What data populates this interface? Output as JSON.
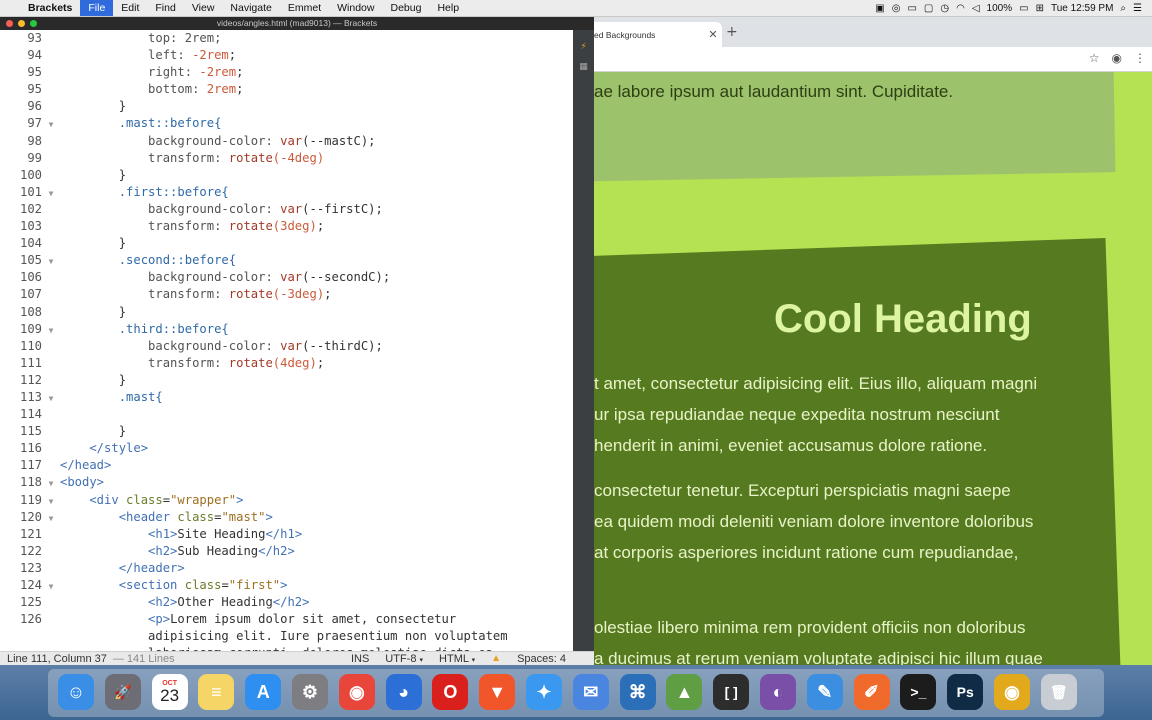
{
  "menubar": {
    "app_name": "Brackets",
    "menus": [
      "File",
      "Edit",
      "Find",
      "View",
      "Navigate",
      "Emmet",
      "Window",
      "Debug",
      "Help"
    ],
    "active_menu": "File",
    "battery": "100%",
    "clock": "Tue 12:59 PM"
  },
  "editor": {
    "window_title": "videos/angles.html (mad9013) — Brackets",
    "lines": [
      {
        "n": "93",
        "fold": "",
        "code": [
          {
            "t": "            top: 2rem;",
            "c": "k-prop"
          }
        ]
      },
      {
        "n": "94",
        "fold": "",
        "code": [
          {
            "t": "            left: ",
            "c": "k-prop"
          },
          {
            "t": "-2rem",
            "c": "k-val"
          },
          {
            "t": ";",
            "c": "txt"
          }
        ]
      },
      {
        "n": "95",
        "fold": "",
        "code": [
          {
            "t": "            right: ",
            "c": "k-prop"
          },
          {
            "t": "-2rem",
            "c": "k-val"
          },
          {
            "t": ";",
            "c": "txt"
          }
        ]
      },
      {
        "n": "95",
        "fold": "",
        "code": [
          {
            "t": "            bottom: ",
            "c": "k-prop"
          },
          {
            "t": "2rem",
            "c": "k-val"
          },
          {
            "t": ";",
            "c": "txt"
          }
        ]
      },
      {
        "n": "96",
        "fold": "",
        "code": [
          {
            "t": "        }",
            "c": "txt"
          }
        ]
      },
      {
        "n": "97",
        "fold": "▼",
        "code": [
          {
            "t": "        .mast::before{",
            "c": "k-sel"
          }
        ]
      },
      {
        "n": "98",
        "fold": "",
        "code": [
          {
            "t": "            background-color: ",
            "c": "k-prop"
          },
          {
            "t": "var",
            "c": "k-fn"
          },
          {
            "t": "(--mastC);",
            "c": "txt"
          }
        ]
      },
      {
        "n": "99",
        "fold": "",
        "code": [
          {
            "t": "            transform: ",
            "c": "k-prop"
          },
          {
            "t": "rotate",
            "c": "k-fn"
          },
          {
            "t": "(-4deg)",
            "c": "k-val"
          }
        ]
      },
      {
        "n": "100",
        "fold": "",
        "code": [
          {
            "t": "        }",
            "c": "txt"
          }
        ]
      },
      {
        "n": "101",
        "fold": "▼",
        "code": [
          {
            "t": "        .first::before{",
            "c": "k-sel"
          }
        ]
      },
      {
        "n": "102",
        "fold": "",
        "code": [
          {
            "t": "            background-color: ",
            "c": "k-prop"
          },
          {
            "t": "var",
            "c": "k-fn"
          },
          {
            "t": "(--firstC);",
            "c": "txt"
          }
        ]
      },
      {
        "n": "103",
        "fold": "",
        "code": [
          {
            "t": "            transform: ",
            "c": "k-prop"
          },
          {
            "t": "rotate",
            "c": "k-fn"
          },
          {
            "t": "(3deg)",
            "c": "k-val"
          },
          {
            "t": ";",
            "c": "txt"
          }
        ]
      },
      {
        "n": "104",
        "fold": "",
        "code": [
          {
            "t": "        }",
            "c": "txt"
          }
        ]
      },
      {
        "n": "105",
        "fold": "▼",
        "code": [
          {
            "t": "        .second::before{",
            "c": "k-sel"
          }
        ]
      },
      {
        "n": "106",
        "fold": "",
        "code": [
          {
            "t": "            background-color: ",
            "c": "k-prop"
          },
          {
            "t": "var",
            "c": "k-fn"
          },
          {
            "t": "(--secondC);",
            "c": "txt"
          }
        ]
      },
      {
        "n": "107",
        "fold": "",
        "code": [
          {
            "t": "            transform: ",
            "c": "k-prop"
          },
          {
            "t": "rotate",
            "c": "k-fn"
          },
          {
            "t": "(-3deg)",
            "c": "k-val"
          },
          {
            "t": ";",
            "c": "txt"
          }
        ]
      },
      {
        "n": "108",
        "fold": "",
        "code": [
          {
            "t": "        }",
            "c": "txt"
          }
        ]
      },
      {
        "n": "109",
        "fold": "▼",
        "code": [
          {
            "t": "        .third::before{",
            "c": "k-sel"
          }
        ]
      },
      {
        "n": "110",
        "fold": "",
        "code": [
          {
            "t": "            background-color: ",
            "c": "k-prop"
          },
          {
            "t": "var",
            "c": "k-fn"
          },
          {
            "t": "(--thirdC);",
            "c": "txt"
          }
        ]
      },
      {
        "n": "111",
        "fold": "",
        "code": [
          {
            "t": "            transform: ",
            "c": "k-prop"
          },
          {
            "t": "rotate",
            "c": "k-fn"
          },
          {
            "t": "(4deg)",
            "c": "k-val"
          },
          {
            "t": ";",
            "c": "txt"
          }
        ]
      },
      {
        "n": "112",
        "fold": "",
        "code": [
          {
            "t": "        }",
            "c": "txt"
          }
        ]
      },
      {
        "n": "113",
        "fold": "▼",
        "code": [
          {
            "t": "        .mast{",
            "c": "k-sel"
          }
        ]
      },
      {
        "n": "114",
        "fold": "",
        "code": [
          {
            "t": "",
            "c": "txt"
          }
        ]
      },
      {
        "n": "115",
        "fold": "",
        "code": [
          {
            "t": "        }",
            "c": "txt"
          }
        ]
      },
      {
        "n": "116",
        "fold": "",
        "code": [
          {
            "t": "    </style>",
            "c": "k-tag"
          }
        ]
      },
      {
        "n": "117",
        "fold": "",
        "code": [
          {
            "t": "</head>",
            "c": "k-tag"
          }
        ]
      },
      {
        "n": "118",
        "fold": "▼",
        "code": [
          {
            "t": "<body>",
            "c": "k-tag"
          }
        ]
      },
      {
        "n": "119",
        "fold": "▼",
        "code": [
          {
            "t": "    <div ",
            "c": "k-tag"
          },
          {
            "t": "class",
            "c": "k-attr"
          },
          {
            "t": "=",
            "c": "txt"
          },
          {
            "t": "\"wrapper\"",
            "c": "k-str"
          },
          {
            "t": ">",
            "c": "k-tag"
          }
        ]
      },
      {
        "n": "120",
        "fold": "▼",
        "code": [
          {
            "t": "        <header ",
            "c": "k-tag"
          },
          {
            "t": "class",
            "c": "k-attr"
          },
          {
            "t": "=",
            "c": "txt"
          },
          {
            "t": "\"mast\"",
            "c": "k-str"
          },
          {
            "t": ">",
            "c": "k-tag"
          }
        ]
      },
      {
        "n": "121",
        "fold": "",
        "code": [
          {
            "t": "            <h1>",
            "c": "k-tag"
          },
          {
            "t": "Site Heading",
            "c": "txt"
          },
          {
            "t": "</h1>",
            "c": "k-tag"
          }
        ]
      },
      {
        "n": "122",
        "fold": "",
        "code": [
          {
            "t": "            <h2>",
            "c": "k-tag"
          },
          {
            "t": "Sub Heading",
            "c": "txt"
          },
          {
            "t": "</h2>",
            "c": "k-tag"
          }
        ]
      },
      {
        "n": "123",
        "fold": "",
        "code": [
          {
            "t": "        </header>",
            "c": "k-tag"
          }
        ]
      },
      {
        "n": "124",
        "fold": "▼",
        "code": [
          {
            "t": "        <section ",
            "c": "k-tag"
          },
          {
            "t": "class",
            "c": "k-attr"
          },
          {
            "t": "=",
            "c": "txt"
          },
          {
            "t": "\"first\"",
            "c": "k-str"
          },
          {
            "t": ">",
            "c": "k-tag"
          }
        ]
      },
      {
        "n": "125",
        "fold": "",
        "code": [
          {
            "t": "            <h2>",
            "c": "k-tag"
          },
          {
            "t": "Other Heading",
            "c": "txt"
          },
          {
            "t": "</h2>",
            "c": "k-tag"
          }
        ]
      },
      {
        "n": "126",
        "fold": "",
        "code": [
          {
            "t": "            <p>",
            "c": "k-tag"
          },
          {
            "t": "Lorem ipsum dolor sit amet, consectetur",
            "c": "txt"
          }
        ]
      },
      {
        "n": "",
        "fold": "",
        "code": [
          {
            "t": "            adipisicing elit. Iure praesentium non voluptatem",
            "c": "txt"
          }
        ]
      },
      {
        "n": "",
        "fold": "",
        "code": [
          {
            "t": "            laboriosam corrupti, dolores molestiae dicta ea",
            "c": "txt"
          }
        ]
      }
    ]
  },
  "statusbar": {
    "position": "Line 111, Column 37",
    "line_count": "141 Lines",
    "mode": "INS",
    "encoding": "UTF-8",
    "language": "HTML",
    "spaces": "Spaces: 4"
  },
  "browser": {
    "tab_title": "ed Backgrounds",
    "mast_text": "ae labore ipsum aut laudantium sint. Cupiditate.",
    "heading": "Cool Heading",
    "para1": [
      "t amet, consectetur adipisicing elit. Eius illo, aliquam magni",
      "ur ipsa repudiandae neque expedita nostrum nesciunt",
      "henderit in animi, eveniet accusamus dolore ratione."
    ],
    "para2": [
      "consectetur tenetur. Excepturi perspiciatis magni saepe",
      "ea quidem modi deleniti veniam dolore inventore doloribus",
      "at corporis asperiores incidunt ratione cum repudiandae,"
    ],
    "para3": [
      "olestiae libero minima rem provident officiis non doloribus",
      "a ducimus at rerum veniam voluptate adipisci hic illum quae"
    ]
  },
  "dock": {
    "calendar_month": "OCT",
    "calendar_day": "23",
    "items": [
      {
        "name": "finder-icon",
        "glyph": "☺",
        "bg": "#3a8ee6"
      },
      {
        "name": "launchpad-icon",
        "glyph": "🚀",
        "bg": "#6d6d75"
      },
      {
        "name": "calendar-icon",
        "glyph": "",
        "bg": "#ffffff"
      },
      {
        "name": "notes-icon",
        "glyph": "≡",
        "bg": "#f5d565"
      },
      {
        "name": "app-store-icon",
        "glyph": "A",
        "bg": "#2f8ff0"
      },
      {
        "name": "system-preferences-icon",
        "glyph": "⚙",
        "bg": "#7d7d82"
      },
      {
        "name": "chrome-icon",
        "glyph": "◉",
        "bg": "#e9463b"
      },
      {
        "name": "firefox-icon",
        "glyph": "◕",
        "bg": "#2c6fd6"
      },
      {
        "name": "opera-icon",
        "glyph": "O",
        "bg": "#d9201d"
      },
      {
        "name": "brave-icon",
        "glyph": "▼",
        "bg": "#f0562a"
      },
      {
        "name": "safari-icon",
        "glyph": "✦",
        "bg": "#3b98f0"
      },
      {
        "name": "tweetbot-icon",
        "glyph": "✉",
        "bg": "#4a85e0"
      },
      {
        "name": "vscode-icon",
        "glyph": "⌘",
        "bg": "#2a6fb8"
      },
      {
        "name": "android-studio-icon",
        "glyph": "▲",
        "bg": "#5f9e43"
      },
      {
        "name": "brackets-icon",
        "glyph": "[ ]",
        "bg": "#2d2d2d"
      },
      {
        "name": "github-desktop-icon",
        "glyph": "◐",
        "bg": "#7a4fa8"
      },
      {
        "name": "xcode-icon",
        "glyph": "✎",
        "bg": "#3c8ee0"
      },
      {
        "name": "paw-icon",
        "glyph": "✐",
        "bg": "#f06a2c"
      },
      {
        "name": "terminal-icon",
        "glyph": ">_",
        "bg": "#1c1c1c"
      },
      {
        "name": "photoshop-icon",
        "glyph": "Ps",
        "bg": "#0f2b45"
      },
      {
        "name": "chrome-canary-icon",
        "glyph": "◉",
        "bg": "#e3a91c"
      },
      {
        "name": "trash-icon",
        "glyph": "🗑",
        "bg": "#c8cdd3"
      }
    ]
  }
}
